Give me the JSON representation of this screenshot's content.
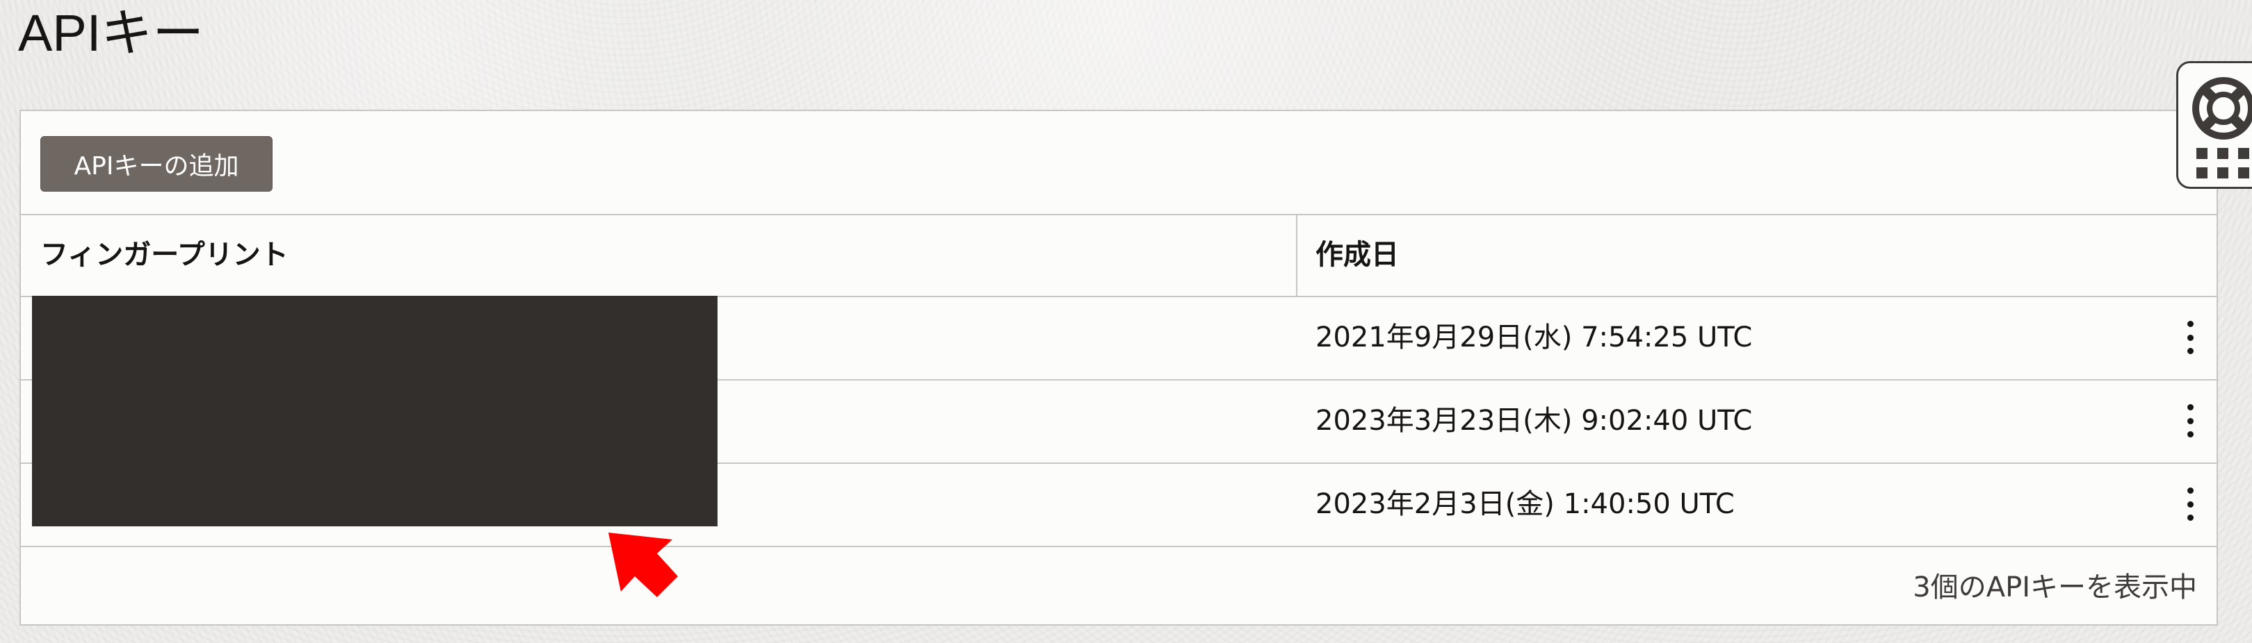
{
  "page": {
    "title": "APIキー"
  },
  "toolbar": {
    "add_button_label": "APIキーの追加"
  },
  "table": {
    "columns": [
      "フィンガープリント",
      "作成日"
    ],
    "rows": [
      {
        "fingerprint": "",
        "created": "2021年9月29日(水) 7:54:25 UTC"
      },
      {
        "fingerprint": "",
        "created": "2023年3月23日(木) 9:02:40 UTC"
      },
      {
        "fingerprint": "",
        "created": "2023年2月3日(金) 1:40:50 UTC"
      }
    ],
    "footer_status": "3個のAPIキーを表示中"
  },
  "icons": {
    "row_actions": "kebab-vertical-icon",
    "help": "lifebuoy-icon",
    "apps": "grid-icon",
    "annotation": "red-arrow-icon"
  },
  "colors": {
    "button_bg": "#6f6762",
    "redaction": "#322f2c",
    "annotation_arrow": "#ff0000"
  }
}
